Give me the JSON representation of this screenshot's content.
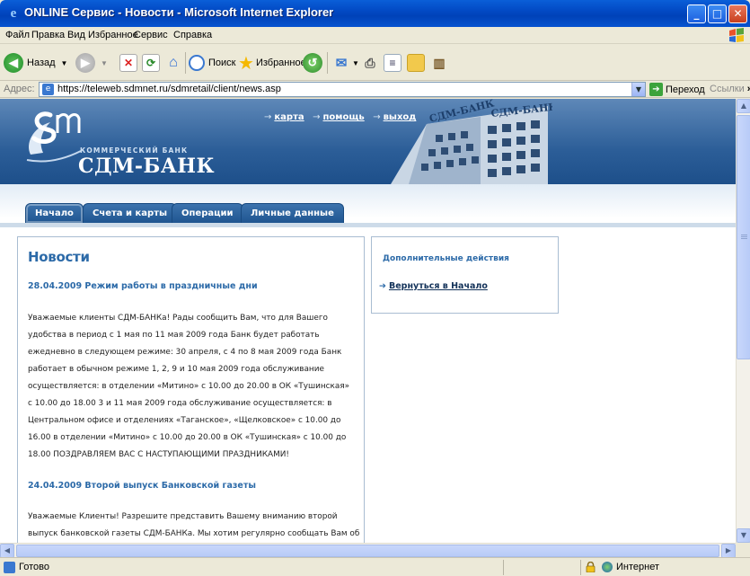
{
  "window": {
    "title": "ONLINE Сервис - Новости - Microsoft Internet Explorer",
    "icon": "ie-icon",
    "controls": [
      "minimize",
      "maximize",
      "close"
    ]
  },
  "menubar": {
    "items": [
      "Файл",
      "Правка",
      "Вид",
      "Избранное",
      "Сервис",
      "Справка"
    ]
  },
  "toolbar": {
    "back_label": "Назад",
    "search_label": "Поиск",
    "favorites_label": "Избранное"
  },
  "address": {
    "label": "Адрес:",
    "url": "https://teleweb.sdmnet.ru/sdmretail/client/news.asp",
    "go_label": "Переход",
    "links_label": "Ссылки"
  },
  "header": {
    "logo_small": "КОММЕРЧЕСКИЙ БАНК",
    "logo_big": "СДМ-БАНК",
    "building_sign": "СДМ-БАНК",
    "top_links": [
      "карта",
      "помощь",
      "выход"
    ]
  },
  "tabs": [
    "Начало",
    "Счета и карты",
    "Операции",
    "Личные данные"
  ],
  "news": {
    "title": "Новости",
    "items": [
      {
        "heading": "28.04.2009 Режим работы в праздничные дни",
        "lines": [
          "Уважаемые клиенты СДМ-БАНКа! Рады сообщить Вам, что для Вашего",
          "удобства в период с 1 мая по 11 мая 2009 года Банк будет работать",
          "ежедневно в следующем режиме: 30 апреля, с 4 по 8 мая 2009 года Банк",
          "работает в обычном режиме 1, 2, 9 и 10 мая 2009 года обслуживание",
          "осуществляется: в отделении «Митино» с 10.00 до 20.00 в ОК «Тушинская»",
          "с 10.00 до 18.00 3 и 11 мая 2009 года обслуживание осуществляется: в",
          "Центральном офисе и отделениях «Таганское», «Щелковское» с 10.00 до",
          "16.00 в отделении «Митино» с 10.00 до 20.00 в ОК «Тушинская» с 10.00 до",
          "18.00 ПОЗДРАВЛЯЕМ ВАС С НАСТУПАЮЩИМИ ПРАЗДНИКАМИ!"
        ]
      },
      {
        "heading": "24.04.2009 Второй выпуск Банковской газеты",
        "lines": [
          "Уважаемые Клиенты! Разрешите представить Вашему вниманию второй",
          "выпуск банковской газеты СДМ-БАНКа. Мы хотим регулярно сообщать Вам об"
        ]
      }
    ]
  },
  "sidebar": {
    "title": "Дополнительные действия",
    "link": "Вернуться в Начало"
  },
  "status": {
    "text": "Готово",
    "zone": "Интернет"
  }
}
